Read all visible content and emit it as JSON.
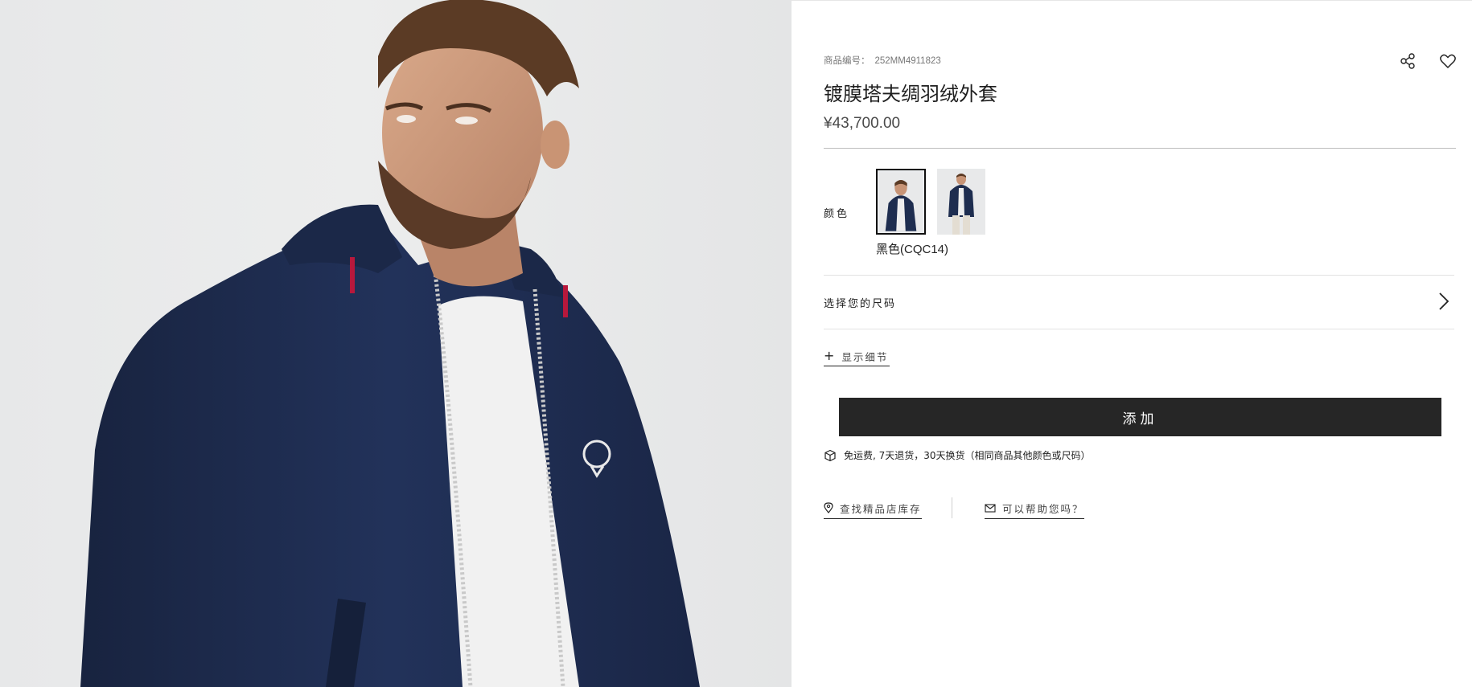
{
  "product": {
    "sku_label": "商品编号：",
    "sku": "252MM4911823",
    "title": "镀膜塔夫绸羽绒外套",
    "price": "¥43,700.00"
  },
  "actions": {
    "share_icon": "share-icon",
    "wishlist_icon": "heart-icon"
  },
  "color": {
    "label": "颜色",
    "selected_name": "黑色(CQC14)",
    "swatches": [
      "navy-jacket-front",
      "navy-jacket-full"
    ]
  },
  "size": {
    "label": "选择您的尺码",
    "icon": "chevron-right-icon"
  },
  "details": {
    "icon": "plus-icon",
    "label": "显示细节"
  },
  "cart": {
    "add_label": "添加"
  },
  "shipping": {
    "icon": "box-icon",
    "text": "免运费, 7天退货，30天换货（相同商品其他颜色或尺码）"
  },
  "links": {
    "store_icon": "location-pin-icon",
    "store_label": "查找精品店库存",
    "help_icon": "mail-icon",
    "help_label": "可以帮助您吗？"
  },
  "colors": {
    "button_bg": "#262626",
    "jacket_navy": "#1e2d4f",
    "photo_bg": "#e9eaeb"
  }
}
